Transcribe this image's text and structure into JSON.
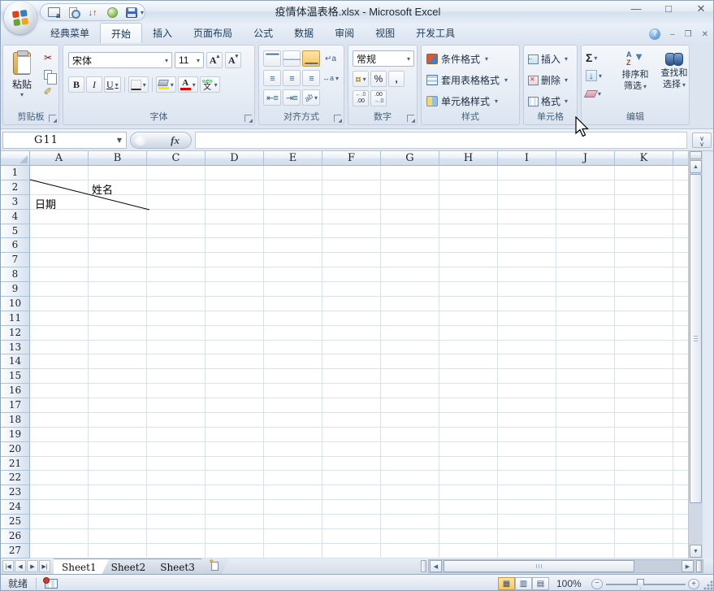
{
  "window": {
    "title": "疫情体温表格.xlsx - Microsoft Excel"
  },
  "qat": {
    "icons": [
      "table-style-icon",
      "print-preview-icon",
      "sort-icon",
      "sphere-icon",
      "save-icon"
    ]
  },
  "tabs": {
    "items": [
      "经典菜单",
      "开始",
      "插入",
      "页面布局",
      "公式",
      "数据",
      "审阅",
      "视图",
      "开发工具"
    ],
    "active_index": 1
  },
  "ribbon": {
    "clipboard": {
      "label": "剪贴板",
      "paste": "粘贴"
    },
    "font": {
      "label": "字体",
      "name": "宋体",
      "size": "11",
      "bold": "B",
      "italic": "I",
      "underline": "U",
      "phonetic_small": "wén",
      "phonetic_big": "文"
    },
    "alignment": {
      "label": "对齐方式"
    },
    "number": {
      "label": "数字",
      "format": "常规",
      "percent": "%",
      "comma": ",",
      "inc_top": "←.0",
      "inc_bottom": ".00",
      "dec_top": ".00",
      "dec_bottom": "→.0"
    },
    "styles": {
      "label": "样式",
      "conditional": "条件格式",
      "table_format": "套用表格格式",
      "cell_styles": "单元格样式"
    },
    "cells": {
      "label": "单元格",
      "insert": "插入",
      "delete": "删除",
      "format": "格式"
    },
    "editing": {
      "label": "编辑",
      "autosum": "Σ",
      "sort_line1": "排序和",
      "sort_line2": "筛选",
      "find_line1": "查找和",
      "find_line2": "选择"
    }
  },
  "formula_bar": {
    "cell_ref": "G11",
    "fx": "fx"
  },
  "grid": {
    "columns": [
      "A",
      "B",
      "C",
      "D",
      "E",
      "F",
      "G",
      "H",
      "I",
      "J",
      "K"
    ],
    "rows": [
      "1",
      "2",
      "3",
      "4",
      "5",
      "6",
      "7",
      "8",
      "9",
      "10",
      "11",
      "12",
      "13",
      "14",
      "15",
      "16",
      "17",
      "18",
      "19",
      "20",
      "21",
      "22",
      "23",
      "24",
      "25",
      "26",
      "27"
    ],
    "diagonal_cell": {
      "top_right": "姓名",
      "bottom_left": "日期"
    }
  },
  "sheets": {
    "tabs": [
      "Sheet1",
      "Sheet2",
      "Sheet3"
    ],
    "active": "Sheet1"
  },
  "status_bar": {
    "ready": "就绪",
    "zoom_level": "100%"
  }
}
